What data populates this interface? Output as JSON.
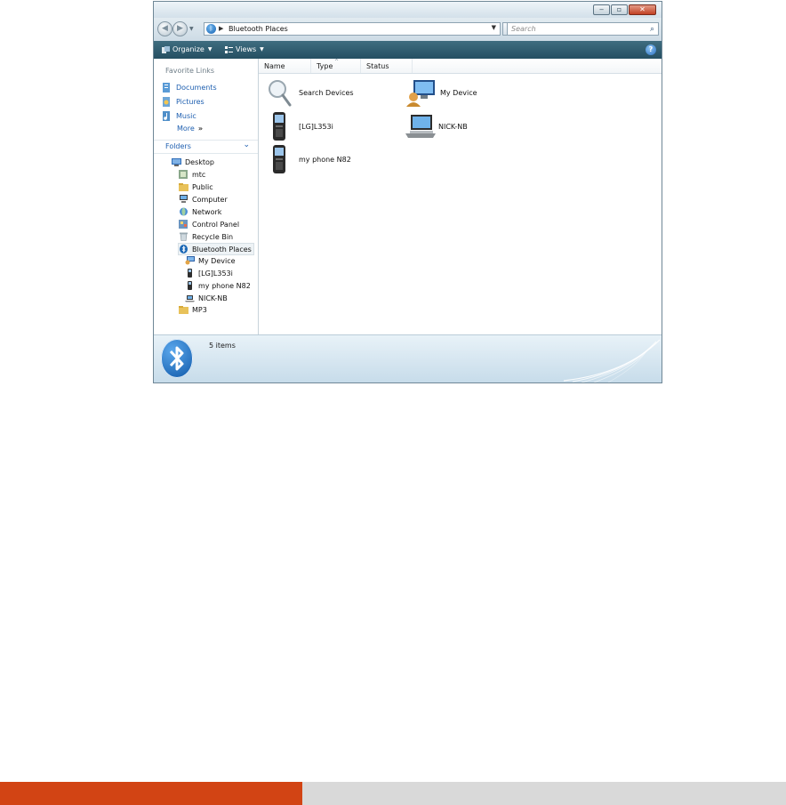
{
  "window": {
    "address": {
      "crumb": "Bluetooth Places"
    },
    "search": {
      "placeholder": "Search"
    },
    "controls": {
      "minimize": "‒",
      "maximize": "▫",
      "close": "✕"
    },
    "toolbar": {
      "organize": "Organize",
      "views": "Views",
      "help": "?"
    }
  },
  "nav_pane": {
    "favorites_header": "Favorite Links",
    "favorites": [
      {
        "label": "Documents",
        "icon": "documents-icon"
      },
      {
        "label": "Pictures",
        "icon": "pictures-icon"
      },
      {
        "label": "Music",
        "icon": "music-icon"
      }
    ],
    "more": "More",
    "folders_header": "Folders",
    "tree": [
      {
        "label": "Desktop",
        "icon": "desktop-icon",
        "level": 0
      },
      {
        "label": "mtc",
        "icon": "user-folder-icon",
        "level": 1
      },
      {
        "label": "Public",
        "icon": "folder-icon",
        "level": 1
      },
      {
        "label": "Computer",
        "icon": "computer-icon",
        "level": 1
      },
      {
        "label": "Network",
        "icon": "network-icon",
        "level": 1
      },
      {
        "label": "Control Panel",
        "icon": "control-panel-icon",
        "level": 1
      },
      {
        "label": "Recycle Bin",
        "icon": "recycle-bin-icon",
        "level": 1
      },
      {
        "label": "Bluetooth Places",
        "icon": "bluetooth-icon",
        "level": 1,
        "selected": true
      },
      {
        "label": "My Device",
        "icon": "my-device-icon",
        "level": 2
      },
      {
        "label": "[LG]L353i",
        "icon": "phone-icon",
        "level": 2
      },
      {
        "label": "my phone N82",
        "icon": "phone-icon",
        "level": 2
      },
      {
        "label": "NICK-NB",
        "icon": "laptop-icon",
        "level": 2
      },
      {
        "label": "MP3",
        "icon": "folder-icon",
        "level": 1
      }
    ]
  },
  "columns": [
    "Name",
    "Type",
    "Status"
  ],
  "items": [
    {
      "label": "Search Devices",
      "icon": "search-devices-icon"
    },
    {
      "label": "My Device",
      "icon": "my-device-icon"
    },
    {
      "label": "[LG]L353i",
      "icon": "phone-icon"
    },
    {
      "label": "NICK-NB",
      "icon": "laptop-icon"
    },
    {
      "label": "my phone N82",
      "icon": "phone-icon"
    }
  ],
  "status_bar": {
    "count": "5 items"
  },
  "colors": {
    "command_bar": "#2d5a6d",
    "link": "#1e5fb0",
    "page_bar_left": "#d24414",
    "page_bar_right": "#d9d9d9"
  }
}
